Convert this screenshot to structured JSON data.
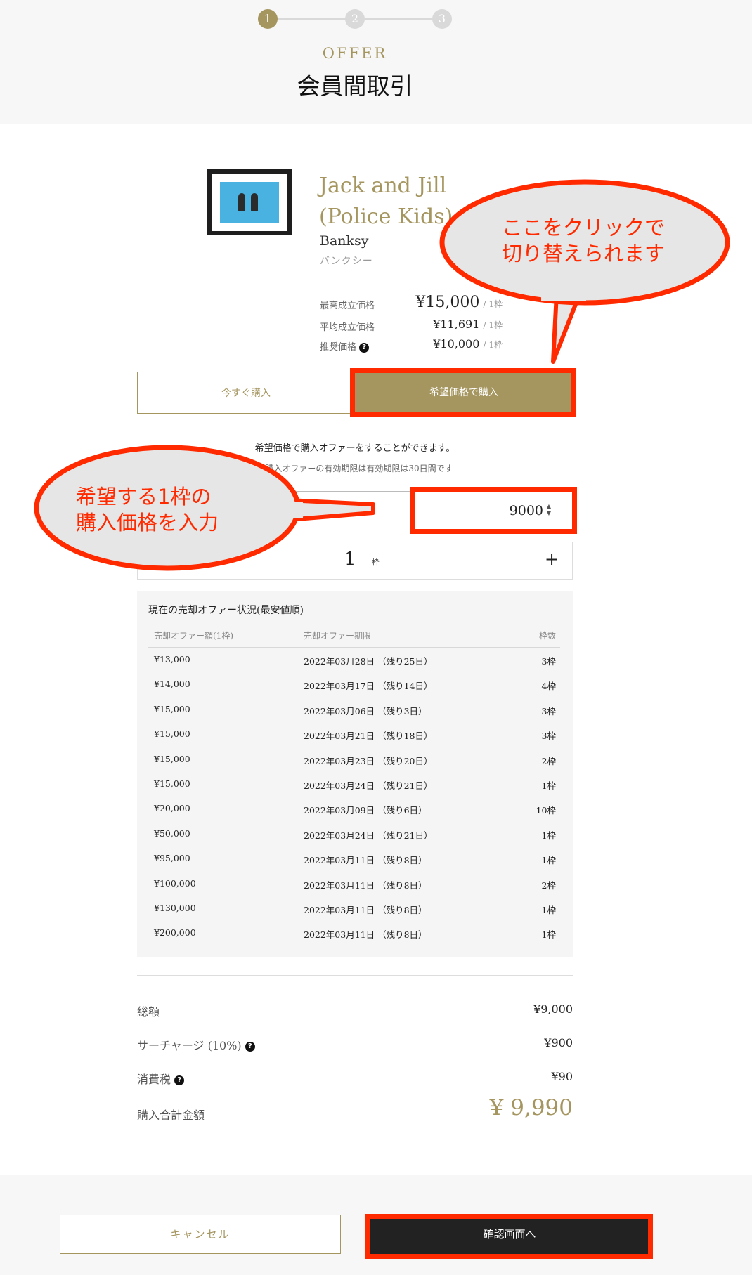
{
  "steps": [
    "1",
    "2",
    "3"
  ],
  "header": {
    "offer_label": "OFFER",
    "title": "会員間取引"
  },
  "artwork": {
    "title_line1": "Jack and Jill",
    "title_line2": "(Police Kids)",
    "artist": "Banksy",
    "artist_kana": "バンクシー"
  },
  "prices": [
    {
      "label": "最高成立価格",
      "value": "¥15,000",
      "unit": "/ 1枠"
    },
    {
      "label": "平均成立価格",
      "value": "¥11,691",
      "unit": "/ 1枠"
    },
    {
      "label": "推奨価格",
      "value": "¥10,000",
      "unit": "/ 1枠",
      "help": "?"
    }
  ],
  "tabs": {
    "buy_now": "今すぐ購入",
    "buy_offer": "希望価格で購入"
  },
  "offer_form": {
    "description": "希望価格で購入オファーをすることができます。",
    "note": "※購入オファーの有効期限は有効期限は30日間です",
    "price_value": "9000",
    "quantity": "1",
    "quantity_unit": "枠",
    "plus": "+"
  },
  "sell_offers": {
    "title": "現在の売却オファー状況(最安値順)",
    "columns": [
      "売却オファー額(1枠)",
      "売却オファー期限",
      "枠数"
    ],
    "rows": [
      [
        "¥13,000",
        "2022年03月28日 （残り25日）",
        "3枠"
      ],
      [
        "¥14,000",
        "2022年03月17日 （残り14日）",
        "4枠"
      ],
      [
        "¥15,000",
        "2022年03月06日 （残り3日）",
        "3枠"
      ],
      [
        "¥15,000",
        "2022年03月21日 （残り18日）",
        "3枠"
      ],
      [
        "¥15,000",
        "2022年03月23日 （残り20日）",
        "2枠"
      ],
      [
        "¥15,000",
        "2022年03月24日 （残り21日）",
        "1枠"
      ],
      [
        "¥20,000",
        "2022年03月09日 （残り6日）",
        "10枠"
      ],
      [
        "¥50,000",
        "2022年03月24日 （残り21日）",
        "1枠"
      ],
      [
        "¥95,000",
        "2022年03月11日 （残り8日）",
        "1枠"
      ],
      [
        "¥100,000",
        "2022年03月11日 （残り8日）",
        "2枠"
      ],
      [
        "¥130,000",
        "2022年03月11日 （残り8日）",
        "1枠"
      ],
      [
        "¥200,000",
        "2022年03月11日 （残り8日）",
        "1枠"
      ]
    ]
  },
  "summary": {
    "subtotal_label": "総額",
    "subtotal_value": "¥9,000",
    "surcharge_label": "サーチャージ (10%)",
    "surcharge_value": "¥900",
    "tax_label": "消費税",
    "tax_value": "¥90",
    "total_label": "購入合計金額",
    "total_value": "¥ 9,990"
  },
  "footer": {
    "cancel": "キャンセル",
    "confirm": "確認画面へ"
  },
  "annotations": {
    "callout_tab_line1": "ここをクリックで",
    "callout_tab_line2": "切り替えられます",
    "callout_price_line1": "希望する1枠の",
    "callout_price_line2": "購入価格を入力",
    "color": "#ff2a00"
  },
  "colors": {
    "accent": "#a59660",
    "dark": "#222222",
    "panel": "#f5f5f5"
  }
}
